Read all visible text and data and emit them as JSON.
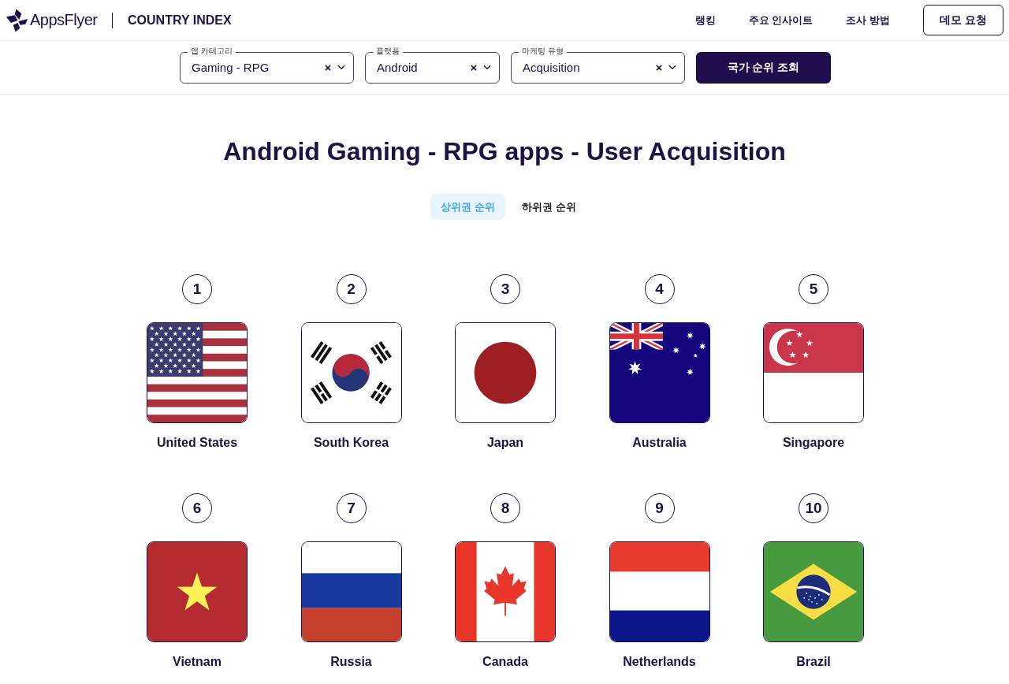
{
  "header": {
    "logo_text": "AppsFlyer",
    "product": "COUNTRY INDEX",
    "nav": [
      "랭킹",
      "주요 인사이트",
      "조사 방법"
    ],
    "cta": "데모 요청"
  },
  "filters": [
    {
      "label": "앱 카테고리",
      "value": "Gaming - RPG"
    },
    {
      "label": "플랫폼",
      "value": "Android"
    },
    {
      "label": "마케팅 유형",
      "value": "Acquisition"
    }
  ],
  "search_button": "국가 순위 조회",
  "title": "Android Gaming - RPG apps - User Acquisition",
  "tabs": [
    {
      "label": "상위권 순위",
      "selected": true
    },
    {
      "label": "하위권 순위",
      "selected": false
    }
  ],
  "countries": [
    {
      "rank": "1",
      "name": "United States",
      "kind": "us"
    },
    {
      "rank": "2",
      "name": "South Korea",
      "kind": "kr"
    },
    {
      "rank": "3",
      "name": "Japan",
      "kind": "jp"
    },
    {
      "rank": "4",
      "name": "Australia",
      "kind": "au"
    },
    {
      "rank": "5",
      "name": "Singapore",
      "kind": "sg"
    },
    {
      "rank": "6",
      "name": "Vietnam",
      "kind": "vn"
    },
    {
      "rank": "7",
      "name": "Russia",
      "kind": "ru"
    },
    {
      "rank": "8",
      "name": "Canada",
      "kind": "ca"
    },
    {
      "rank": "9",
      "name": "Netherlands",
      "kind": "nl"
    },
    {
      "rank": "10",
      "name": "Brazil",
      "kind": "br"
    }
  ]
}
